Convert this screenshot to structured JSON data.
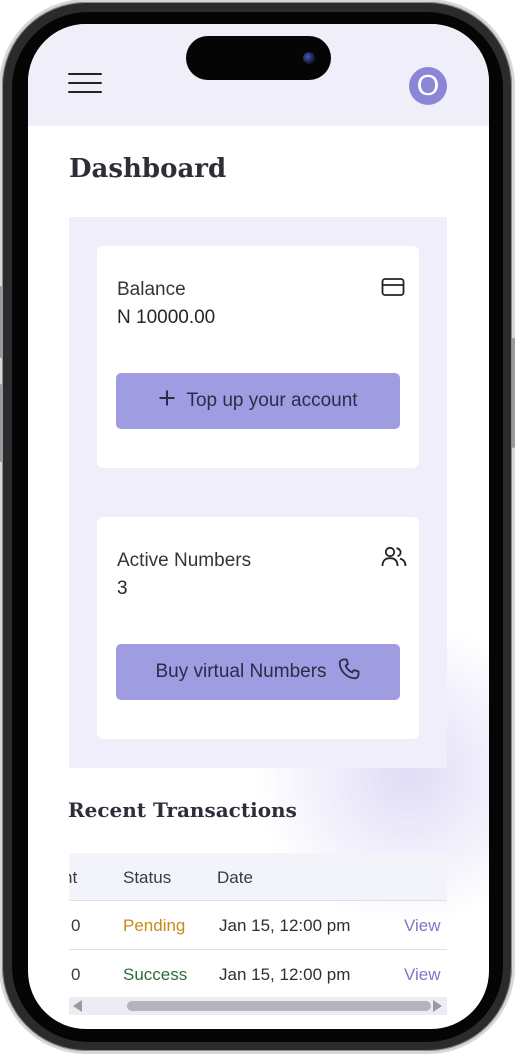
{
  "header": {
    "avatar_initial": "O"
  },
  "page": {
    "title": "Dashboard"
  },
  "balance_card": {
    "label": "Balance",
    "value": "N 10000.00",
    "icon": "credit-card-icon",
    "button_label": "Top up your account",
    "button_icon": "plus-icon"
  },
  "numbers_card": {
    "label": "Active Numbers",
    "value": "3",
    "icon": "users-icon",
    "button_label": "Buy virtual Numbers",
    "button_icon": "phone-icon"
  },
  "transactions": {
    "title": "Recent Transactions",
    "columns": [
      "nt",
      "Status",
      "Date"
    ],
    "rows": [
      {
        "amount": "0",
        "status": "Pending",
        "date": "Jan 15, 12:00 pm",
        "action": "View"
      },
      {
        "amount": "0",
        "status": "Success",
        "date": "Jan 15, 12:00 pm",
        "action": "View"
      }
    ]
  },
  "colors": {
    "accent": "#a09ce2",
    "avatar": "#8c86d8",
    "pending": "#c98a1a",
    "success": "#2e6b3c",
    "link": "#7b79c8"
  }
}
